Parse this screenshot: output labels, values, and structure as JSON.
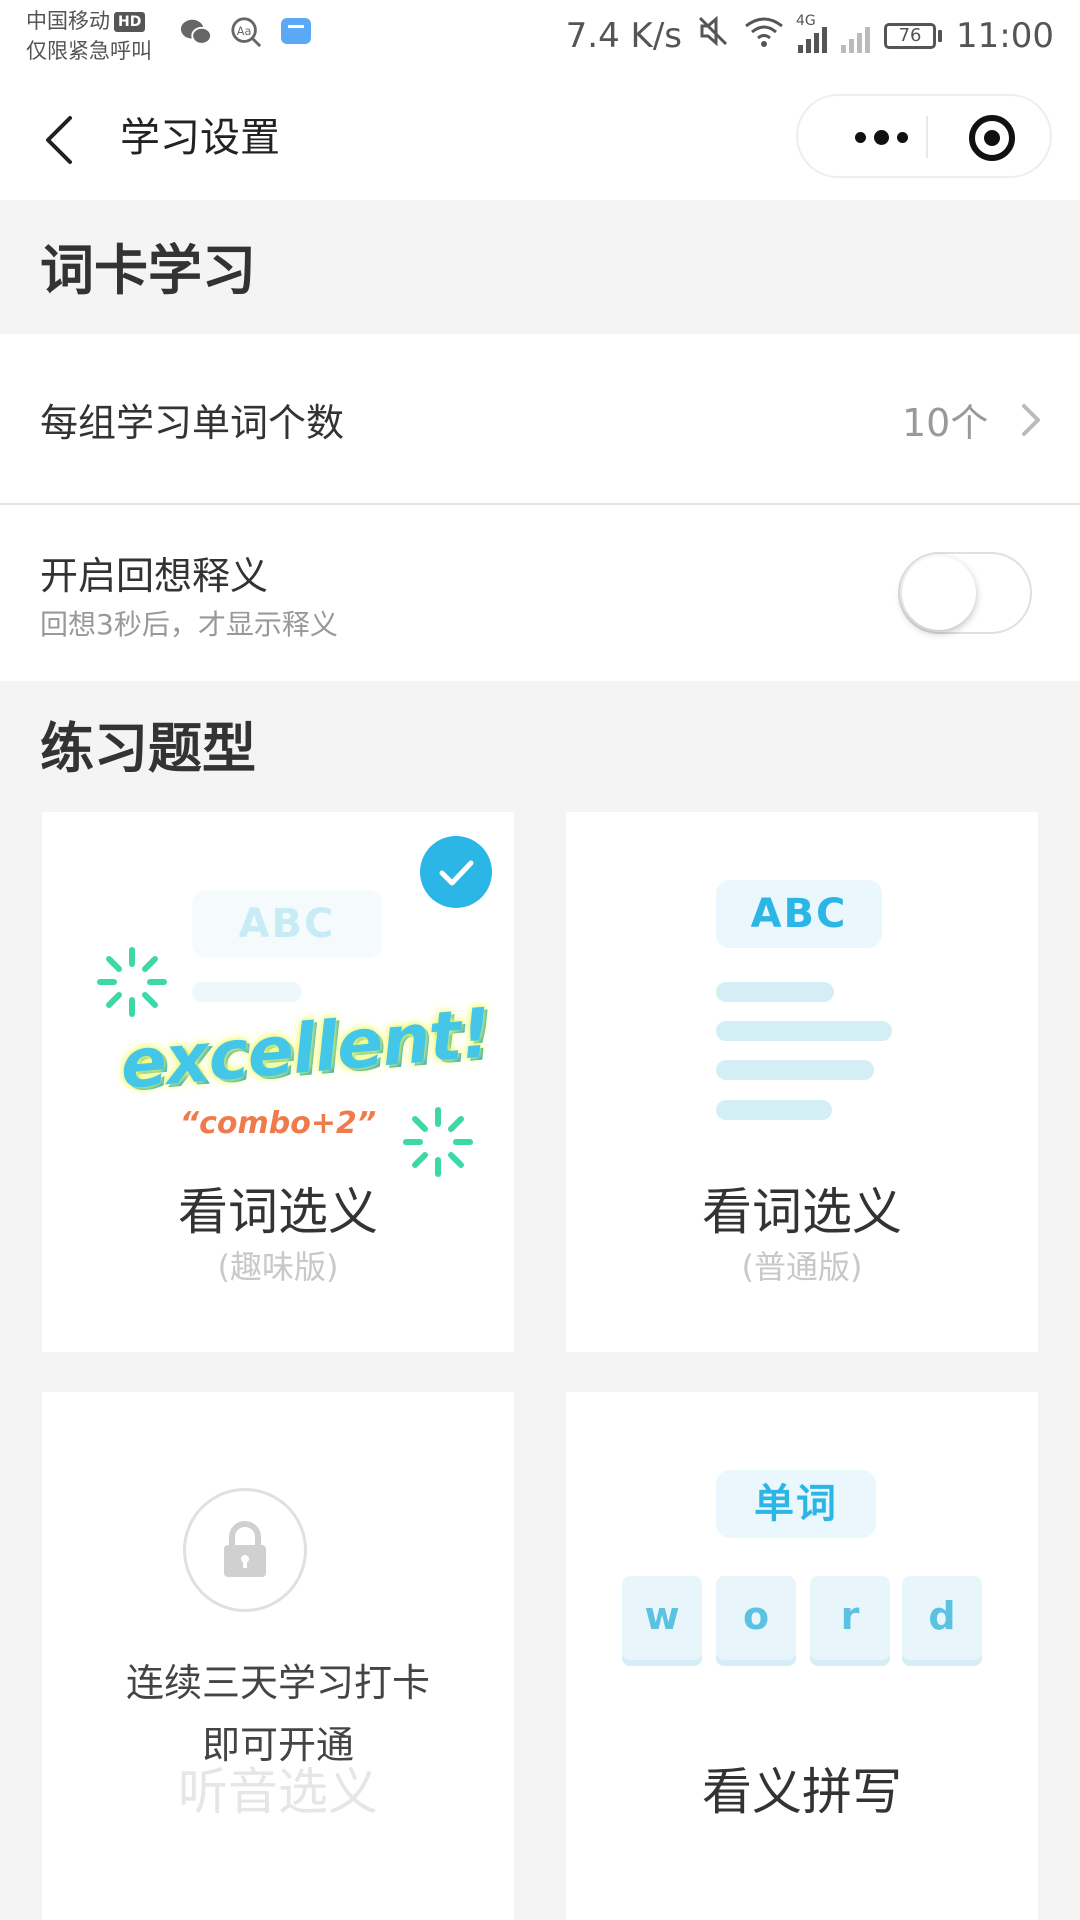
{
  "status_bar": {
    "carrier": "中国移动",
    "hd": "HD",
    "emergency": "仅限紧急呼叫",
    "speed": "7.4 K/s",
    "network": "4G",
    "battery": "76",
    "time": "11:00"
  },
  "nav": {
    "title": "学习设置"
  },
  "word_card": {
    "section_title": "词卡学习",
    "group_count_label": "每组学习单词个数",
    "group_count_value": "10个",
    "recall_label": "开启回想释义",
    "recall_sub": "回想3秒后，才显示释义",
    "recall_enabled": false
  },
  "practice": {
    "section_title": "练习题型",
    "cards": [
      {
        "title": "看词选义",
        "sub": "(趣味版)",
        "selected": true,
        "badge": "excellent!",
        "combo": "“combo+2”",
        "tag": "ABC"
      },
      {
        "title": "看词选义",
        "sub": "(普通版)",
        "selected": false,
        "tag": "ABC"
      },
      {
        "title": "听音选义",
        "locked_text_1": "连续三天学习打卡",
        "locked_text_2": "即可开通",
        "locked": true
      },
      {
        "title": "看义拼写",
        "tag": "单词",
        "letters": [
          "w",
          "o",
          "r",
          "d"
        ]
      }
    ]
  },
  "colors": {
    "accent": "#2cb6e6",
    "background": "#f4f4f4",
    "card": "#ffffff"
  }
}
